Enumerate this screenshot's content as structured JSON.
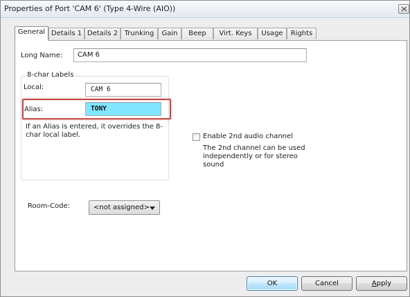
{
  "window": {
    "title": "Properties of Port 'CAM 6' (Type 4-Wire (AIO))"
  },
  "tabs": [
    {
      "label": "General",
      "active": true
    },
    {
      "label": "Details 1",
      "active": false
    },
    {
      "label": "Details 2",
      "active": false
    },
    {
      "label": "Trunking",
      "active": false
    },
    {
      "label": "Gain",
      "active": false
    },
    {
      "label": "Beep",
      "active": false
    },
    {
      "label": "Virt. Keys",
      "active": false
    },
    {
      "label": "Usage",
      "active": false
    },
    {
      "label": "Rights",
      "active": false
    }
  ],
  "general": {
    "long_name_label": "Long Name:",
    "long_name_value": "CAM 6",
    "labels_group_title": "8-char Labels",
    "local_label": "Local:",
    "local_value": "CAM 6",
    "alias_label": "Alias:",
    "alias_value": "TONY",
    "alias_hint": "If an Alias is entered, it overrides the 8-char local label.",
    "enable_2nd_audio_label": "Enable 2nd audio channel",
    "enable_2nd_audio_checked": false,
    "audio_hint": "The 2nd channel can be used independently or for stereo sound",
    "room_code_label": "Room-Code:",
    "room_code_value": "<not assigned>"
  },
  "buttons": {
    "ok": "OK",
    "cancel": "Cancel",
    "apply": "Apply"
  },
  "colors": {
    "alias_highlight_border": "#c24a43",
    "alias_field_background": "#80e6ff"
  }
}
